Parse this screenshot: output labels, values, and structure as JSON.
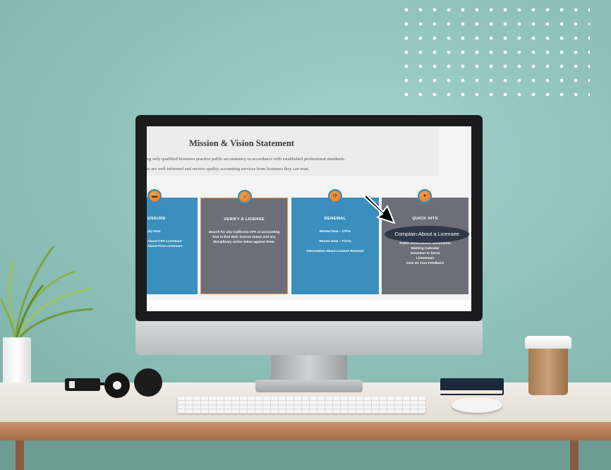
{
  "screen": {
    "mission": {
      "title": "Mission & Vision Statement",
      "line1": "ng only qualified licensees practice public accountancy in accordance with established professional standards.",
      "line2": "rs are well-informed and receive quality accounting services from licensees they can trust."
    },
    "cards": [
      {
        "title": "ENSURE",
        "items": [
          "ply Now",
          "About CPA Licensure",
          "About Firm Licensure"
        ],
        "bg": "#3a8fbe",
        "icon": "folder-icon"
      },
      {
        "title": "VERIFY A LICENSE",
        "body": "Search for any California CPA or accounting firm to find their license status and any disciplinary action taken against them.",
        "bg": "#6c6f78",
        "icon": "search-icon"
      },
      {
        "title": "RENEWAL",
        "items": [
          "Renew Now – CPAs",
          "Renew Now – Firms",
          "Information About License Renewal"
        ],
        "bg": "#3a8fbe",
        "icon": "renew-icon"
      },
      {
        "title": "QUICK HITS",
        "items": [
          "Public Enforcement Documents",
          "Meeting Calendar",
          "Volunteer to Serve",
          "Livestream",
          "Give Us Your Feedback"
        ],
        "bg": "#6c6f78",
        "icon": "bulb-icon"
      }
    ],
    "callout": {
      "label": "Complain About a Licensee"
    }
  },
  "colors": {
    "wall": "#8fc3bc",
    "card_blue": "#3a8fbe",
    "card_gray": "#6c6f78",
    "callout": "#2f3846",
    "icon_orange": "#e58a34"
  }
}
